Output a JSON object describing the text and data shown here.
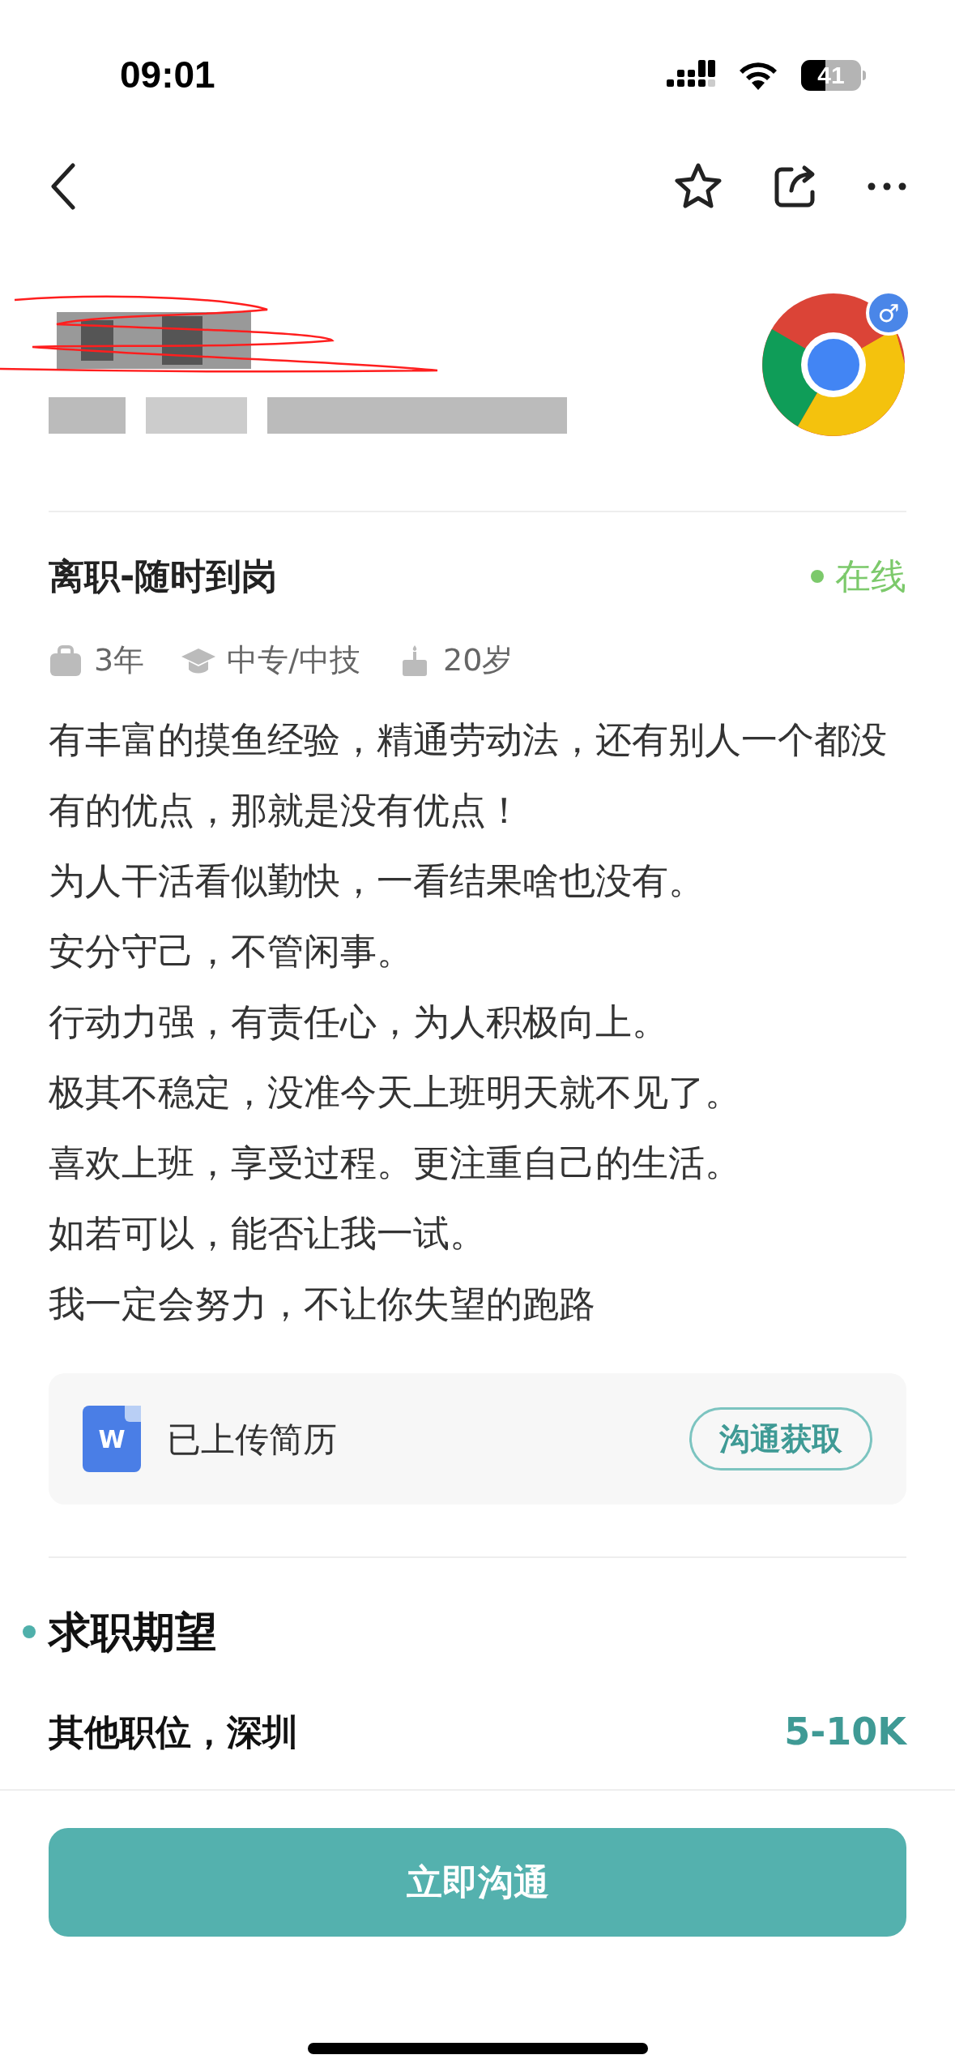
{
  "status_bar": {
    "time": "09:01",
    "battery": "41"
  },
  "profile": {
    "status": "离职-随时到岗",
    "online": true,
    "online_label": "在线",
    "gender": "♂"
  },
  "facts": [
    {
      "kind": "experience",
      "text": "3年"
    },
    {
      "kind": "education",
      "text": "中专/中技"
    },
    {
      "kind": "age",
      "text": "20岁"
    }
  ],
  "description": [
    "有丰富的摸鱼经验，精通劳动法，还有别人一个都没有的优点，那就是没有优点！",
    "为人干活看似勤快，一看结果啥也没有。",
    "安分守己，不管闲事。",
    "行动力强，有责任心，为人积极向上。",
    "极其不稳定，没准今天上班明天就不见了。",
    "喜欢上班，享受过程。更注重自己的生活。",
    "如若可以，能否让我一试。",
    "我一定会努力，不让你失望的跑路"
  ],
  "resume": {
    "icon_letter": "W",
    "label": "已上传简历",
    "button": "沟通获取"
  },
  "expectation": {
    "title": "求职期望",
    "position": "其他职位，深圳",
    "salary": "5-10K"
  },
  "action_button": "立即沟通"
}
